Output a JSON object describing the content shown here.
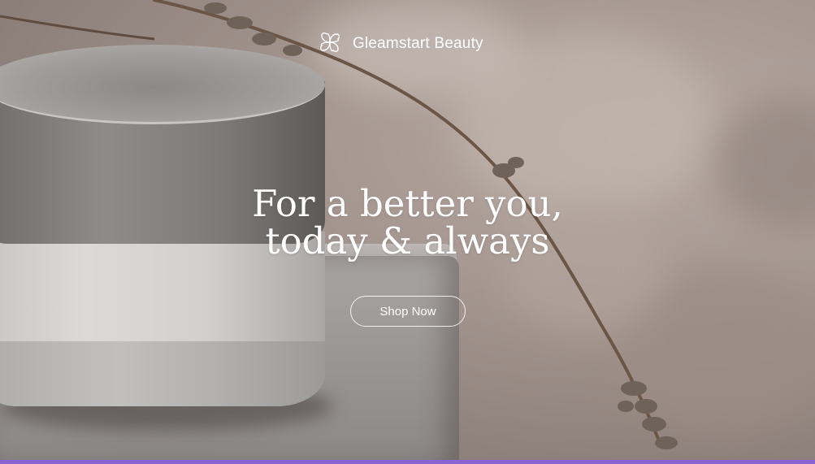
{
  "brand": {
    "name": "Gleamstart Beauty",
    "logo_icon": "flower-icon"
  },
  "hero": {
    "headline_line1": "For a better you,",
    "headline_line2": "today & always",
    "cta_label": "Shop Now"
  },
  "colors": {
    "text": "#ffffff",
    "accent_bar": "#8a63d2"
  }
}
